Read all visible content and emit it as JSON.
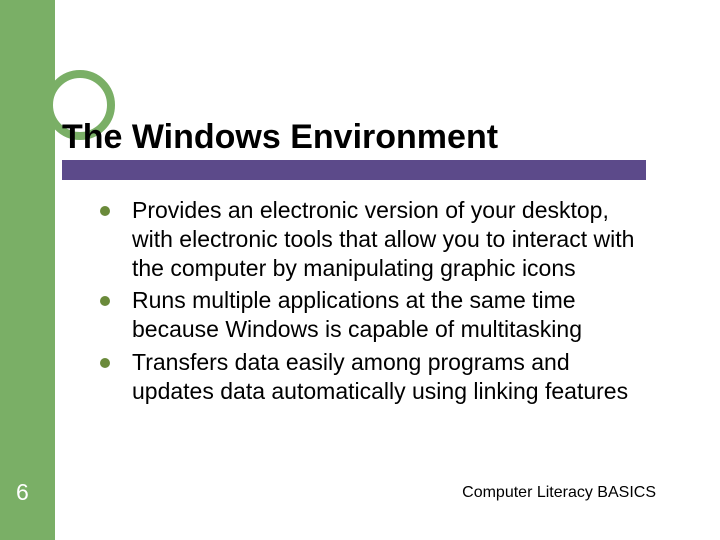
{
  "title": "The Windows Environment",
  "bullets": [
    "Provides an electronic version of your desktop, with electronic tools that allow you to interact with the computer by manipulating graphic icons",
    "Runs multiple applications at the same time because Windows is capable of multitasking",
    "Transfers data easily among programs and updates data automatically using linking features"
  ],
  "page_number": "6",
  "footer": "Computer Literacy BASICS"
}
